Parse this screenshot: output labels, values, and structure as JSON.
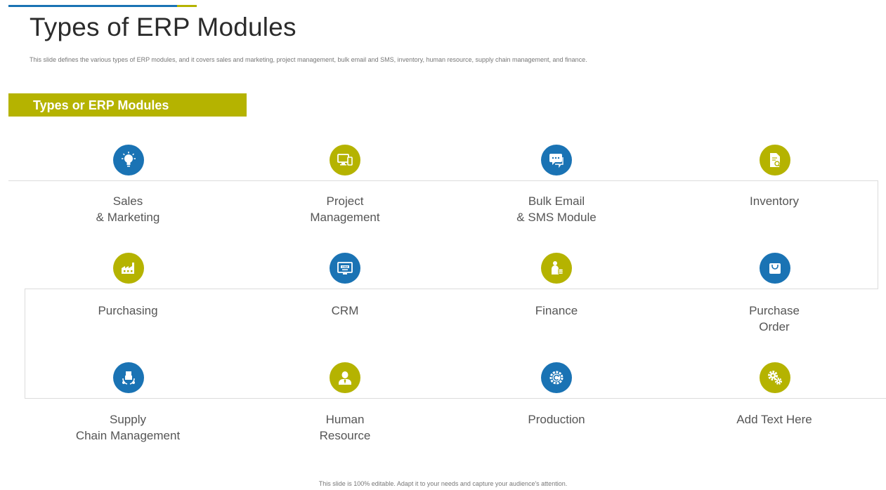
{
  "slide": {
    "title": "Types of ERP Modules",
    "subtitle": "This slide defines the various types of ERP modules, and it covers sales and marketing, project management, bulk email and SMS, inventory, human resource, supply chain management, and finance.",
    "banner_label": "Types or ERP Modules",
    "footer": "This slide is 100% editable. Adapt it to your needs and capture your audience's attention."
  },
  "colors": {
    "blue": "#1a73b4",
    "olive": "#b5b300"
  },
  "modules": [
    {
      "line1": "Sales",
      "line2": "& Marketing",
      "icon": "lightbulb-icon",
      "color": "blue"
    },
    {
      "line1": "Project",
      "line2": "Management",
      "icon": "devices-icon",
      "color": "olive"
    },
    {
      "line1": "Bulk Email",
      "line2": "& SMS Module",
      "icon": "chat-icon",
      "color": "blue"
    },
    {
      "line1": "Inventory",
      "line2": "",
      "icon": "document-search-icon",
      "color": "olive"
    },
    {
      "line1": "Purchasing",
      "line2": "",
      "icon": "factory-icon",
      "color": "olive"
    },
    {
      "line1": "CRM",
      "line2": "",
      "icon": "crm-monitor-icon",
      "color": "blue"
    },
    {
      "line1": "Finance",
      "line2": "",
      "icon": "person-coins-icon",
      "color": "olive"
    },
    {
      "line1": "Purchase",
      "line2": "Order",
      "icon": "shopping-bag-icon",
      "color": "blue"
    },
    {
      "line1": "Supply",
      "line2": "Chain Management",
      "icon": "delivery-cycle-icon",
      "color": "blue"
    },
    {
      "line1": "Human",
      "line2": "Resource",
      "icon": "employee-icon",
      "color": "olive"
    },
    {
      "line1": "Production",
      "line2": "",
      "icon": "gear-cycle-icon",
      "color": "blue"
    },
    {
      "line1": "Add Text Here",
      "line2": "",
      "icon": "gears-icon",
      "color": "olive"
    }
  ]
}
